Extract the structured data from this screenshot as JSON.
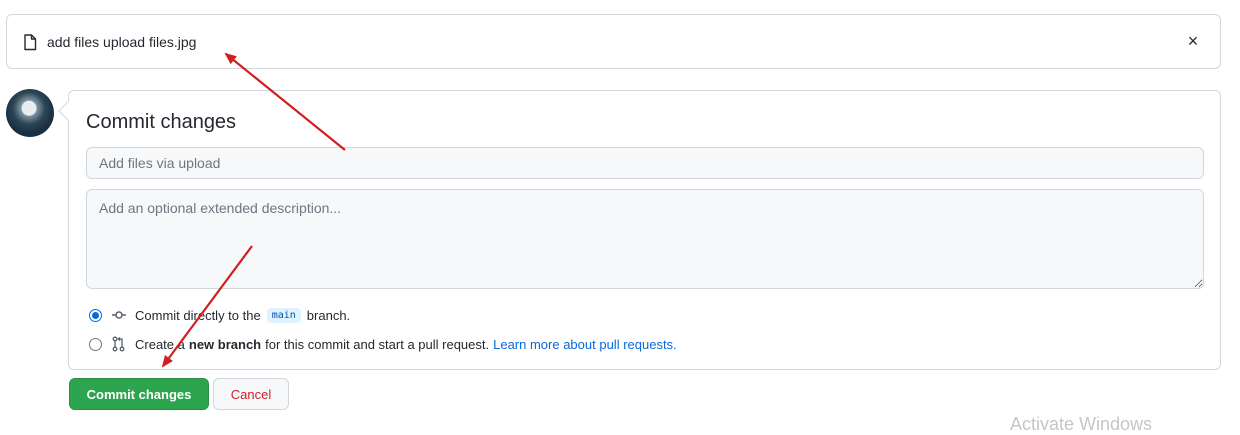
{
  "file_bar": {
    "file_name": "add files upload files.jpg",
    "close_symbol": "×",
    "icon": "file-icon"
  },
  "commit_form": {
    "title": "Commit changes",
    "summary_placeholder": "Add files via upload",
    "description_placeholder": "Add an optional extended description...",
    "options": [
      {
        "checked": true,
        "icon": "git-commit-icon",
        "text_before": "Commit directly to the",
        "branch": "main",
        "text_after": "branch."
      },
      {
        "checked": false,
        "icon": "git-pull-request-icon",
        "text_before": "Create a",
        "bold": "new branch",
        "text_after": "for this commit and start a pull request.",
        "link": "Learn more about pull requests."
      }
    ]
  },
  "buttons": {
    "commit_label": "Commit changes",
    "cancel_label": "Cancel"
  },
  "watermark": "Activate Windows",
  "colors": {
    "primary_button": "#2da44e",
    "cancel_text": "#cf222e",
    "link": "#0969da",
    "annotation_arrow": "#d11f1f"
  }
}
